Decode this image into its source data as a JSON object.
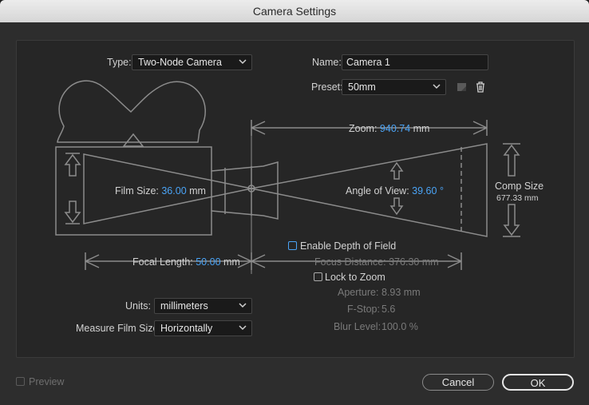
{
  "window": {
    "title": "Camera Settings"
  },
  "type": {
    "label": "Type:",
    "value": "Two-Node Camera"
  },
  "name": {
    "label": "Name:",
    "value": "Camera 1"
  },
  "preset": {
    "label": "Preset:",
    "value": "50mm"
  },
  "diagram": {
    "zoom_label": "Zoom:",
    "zoom_value": "940.74",
    "zoom_unit": "mm",
    "film_size_label": "Film Size:",
    "film_size_value": "36.00",
    "film_size_unit": "mm",
    "angle_label": "Angle of View:",
    "angle_value": "39.60",
    "angle_unit": "°",
    "comp_size_label": "Comp Size",
    "comp_size_value": "677.33 mm",
    "focal_length_label": "Focal Length:",
    "focal_length_value": "50.00",
    "focal_length_unit": "mm",
    "focus_distance_label": "Focus Distance:",
    "focus_distance_value": "376.30 mm"
  },
  "dof": {
    "enable_label": "Enable Depth of Field",
    "lock_zoom_label": "Lock to Zoom",
    "aperture_label": "Aperture:",
    "aperture_value": "8.93 mm",
    "fstop_label": "F-Stop:",
    "fstop_value": "5.6",
    "blur_label": "Blur Level:",
    "blur_value": "100.0 %"
  },
  "units": {
    "label": "Units:",
    "value": "millimeters"
  },
  "measure": {
    "label": "Measure Film Size:",
    "value": "Horizontally"
  },
  "footer": {
    "preview_label": "Preview",
    "cancel_label": "Cancel",
    "ok_label": "OK"
  },
  "colors": {
    "accent": "#4aa3f5",
    "panel": "#262626",
    "dialog": "#2d2d2d"
  }
}
